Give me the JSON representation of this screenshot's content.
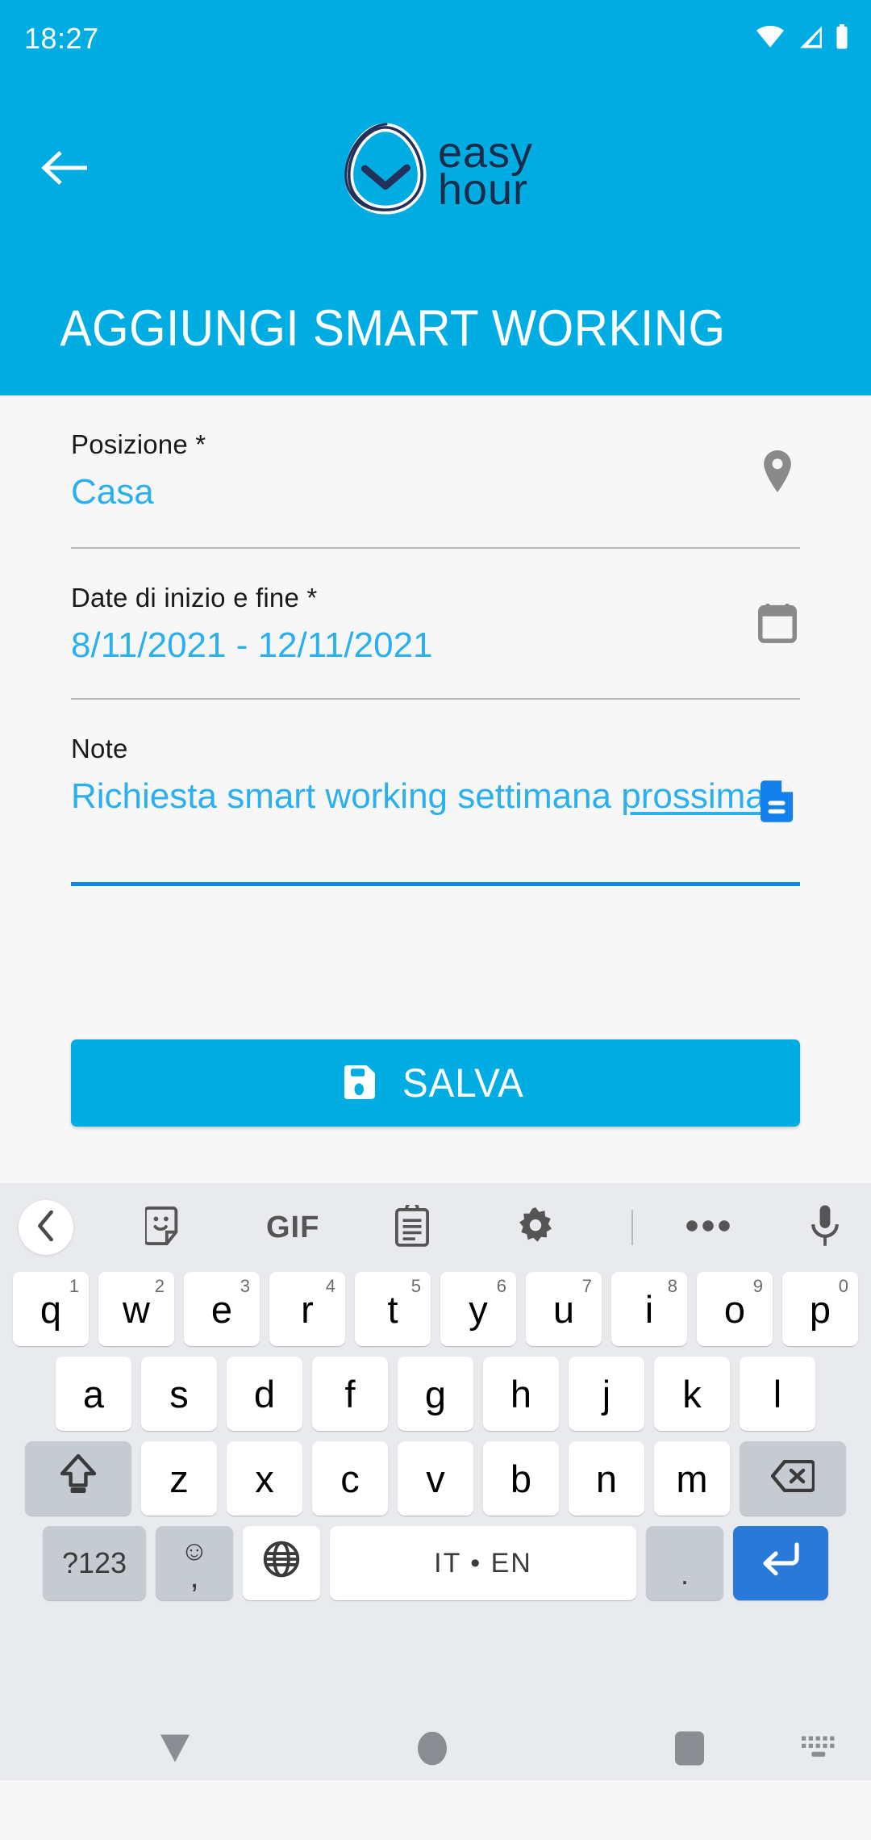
{
  "status_bar": {
    "time": "18:27",
    "icons": [
      "wifi-icon",
      "cellular-signal-icon",
      "battery-icon"
    ]
  },
  "app_bar": {
    "back_icon": "arrow-left-icon",
    "logo": {
      "line1": "easy",
      "line2": "hour",
      "mark": "clock-egg-icon"
    }
  },
  "header": {
    "title": "AGGIUNGI SMART WORKING"
  },
  "form": {
    "fields": [
      {
        "label": "Posizione  *",
        "value": "Casa",
        "icon": "location-pin-icon",
        "focused": false
      },
      {
        "label": "Date di inizio e fine  *",
        "value": "8/11/2021 - 12/11/2021",
        "icon": "calendar-icon",
        "focused": false
      },
      {
        "label": "Note",
        "value_plain": "Richiesta smart working settimana ",
        "value_composing": "prossima",
        "icon": "document-icon",
        "focused": true
      }
    ]
  },
  "actions": {
    "save_label": "SALVA",
    "save_icon": "floppy-save-icon"
  },
  "keyboard": {
    "toolbar": [
      {
        "name": "back-chevron-icon"
      },
      {
        "name": "sticker-icon"
      },
      {
        "name": "gif-icon",
        "label": "GIF"
      },
      {
        "name": "clipboard-icon"
      },
      {
        "name": "gear-icon"
      },
      {
        "name": "divider"
      },
      {
        "name": "more-options-icon"
      },
      {
        "name": "microphone-icon"
      }
    ],
    "row1": [
      {
        "key": "q",
        "hint": "1"
      },
      {
        "key": "w",
        "hint": "2"
      },
      {
        "key": "e",
        "hint": "3"
      },
      {
        "key": "r",
        "hint": "4"
      },
      {
        "key": "t",
        "hint": "5"
      },
      {
        "key": "y",
        "hint": "6"
      },
      {
        "key": "u",
        "hint": "7"
      },
      {
        "key": "i",
        "hint": "8"
      },
      {
        "key": "o",
        "hint": "9"
      },
      {
        "key": "p",
        "hint": "0"
      }
    ],
    "row2": [
      {
        "key": "a"
      },
      {
        "key": "s"
      },
      {
        "key": "d"
      },
      {
        "key": "f"
      },
      {
        "key": "g"
      },
      {
        "key": "h"
      },
      {
        "key": "j"
      },
      {
        "key": "k"
      },
      {
        "key": "l"
      }
    ],
    "row3": [
      {
        "key": "z"
      },
      {
        "key": "x"
      },
      {
        "key": "c"
      },
      {
        "key": "v"
      },
      {
        "key": "b"
      },
      {
        "key": "n"
      },
      {
        "key": "m"
      }
    ],
    "shift_icon": "shift-up-arrow-icon",
    "backspace_icon": "backspace-delete-icon",
    "symbols_label": "?123",
    "emoji_comma": {
      "emoji": "☺",
      "comma": ","
    },
    "globe_icon": "language-globe-icon",
    "space_label": "IT • EN",
    "period_label": ".",
    "enter_icon": "enter-return-icon"
  },
  "nav_bar": {
    "back_icon": "nav-back-down-icon",
    "home_icon": "nav-home-circle-icon",
    "recents_icon": "nav-recents-square-icon",
    "keyboard_toggle_icon": "keyboard-toggle-icon"
  },
  "colors": {
    "brand": "#00ade3",
    "value_blue": "#2ab0ee",
    "focus_blue": "#0f87e8",
    "doc_icon_blue": "#1380ec",
    "enter_blue": "#2979d8",
    "page_bg": "#f7f7f7",
    "keyboard_bg": "#e8eaed"
  }
}
